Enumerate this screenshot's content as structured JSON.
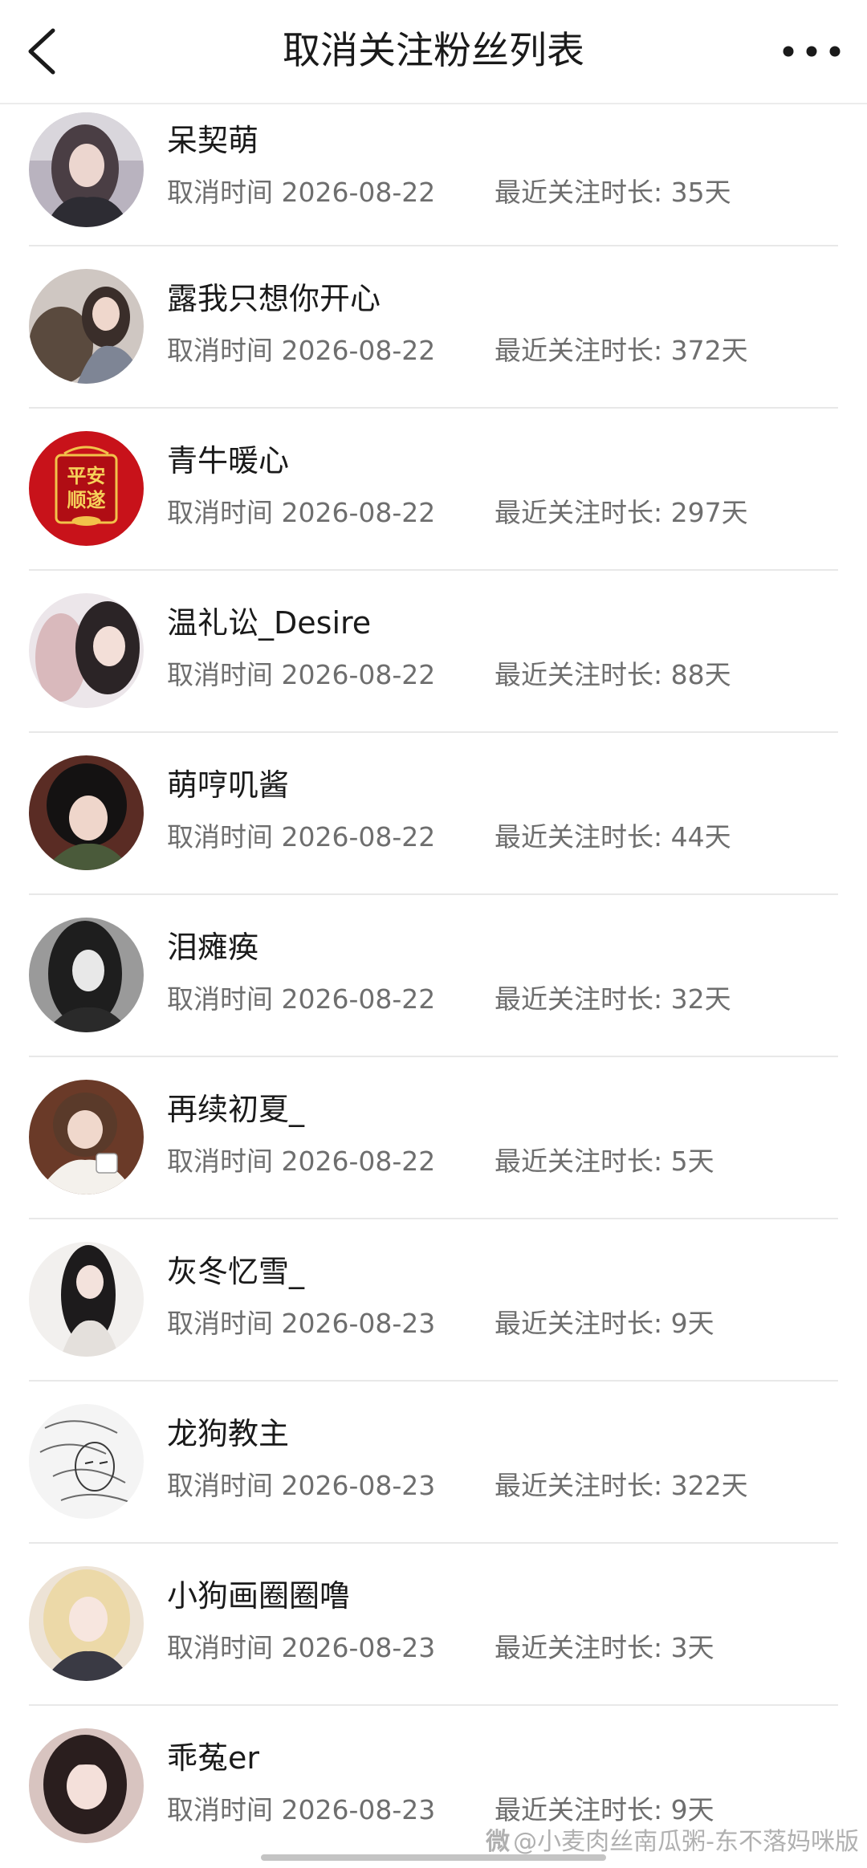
{
  "header": {
    "title": "取消关注粉丝列表"
  },
  "fans": [
    {
      "name": "呆契萌",
      "cancel_time": "取消时间 2026-08-22",
      "duration": "最近关注时长: 35天",
      "avatar_icon": "profile-photo"
    },
    {
      "name": "露我只想你开心",
      "cancel_time": "取消时间 2026-08-22",
      "duration": "最近关注时长: 372天",
      "avatar_icon": "profile-photo"
    },
    {
      "name": "青牛暖心",
      "cancel_time": "取消时间 2026-08-22",
      "duration": "最近关注时长: 297天",
      "avatar_icon": "red-banner-avatar",
      "avatar_text_top": "平安",
      "avatar_text_bottom": "顺遂"
    },
    {
      "name": "温礼讼_Desire",
      "cancel_time": "取消时间 2026-08-22",
      "duration": "最近关注时长: 88天",
      "avatar_icon": "profile-photo"
    },
    {
      "name": "萌哼叽酱",
      "cancel_time": "取消时间 2026-08-22",
      "duration": "最近关注时长: 44天",
      "avatar_icon": "profile-photo"
    },
    {
      "name": "泪瘫痪",
      "cancel_time": "取消时间 2026-08-22",
      "duration": "最近关注时长: 32天",
      "avatar_icon": "profile-photo"
    },
    {
      "name": "再续初夏_",
      "cancel_time": "取消时间 2026-08-22",
      "duration": "最近关注时长: 5天",
      "avatar_icon": "profile-photo"
    },
    {
      "name": "灰冬忆雪_",
      "cancel_time": "取消时间 2026-08-23",
      "duration": "最近关注时长: 9天",
      "avatar_icon": "profile-photo"
    },
    {
      "name": "龙狗教主",
      "cancel_time": "取消时间 2026-08-23",
      "duration": "最近关注时长: 322天",
      "avatar_icon": "sketch-avatar"
    },
    {
      "name": "小狗画圈圈噜",
      "cancel_time": "取消时间 2026-08-23",
      "duration": "最近关注时长: 3天",
      "avatar_icon": "profile-photo"
    },
    {
      "name": "乖菟er",
      "cancel_time": "取消时间 2026-08-23",
      "duration": "最近关注时长: 9天",
      "avatar_icon": "profile-photo"
    }
  ],
  "watermark": {
    "prefix": "微",
    "text": "@小麦肉丝南瓜粥-东不落妈咪版"
  }
}
